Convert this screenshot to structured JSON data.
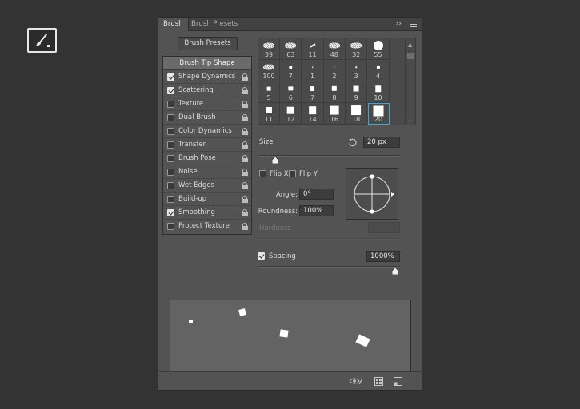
{
  "tool": {
    "icon": "brush-icon"
  },
  "tabs": [
    {
      "label": "Brush",
      "active": true
    },
    {
      "label": "Brush Presets",
      "active": false
    }
  ],
  "tab_more_glyph": "›› ",
  "brush_presets_button": "Brush Presets",
  "options_header": "Brush Tip Shape",
  "options": [
    {
      "label": "Shape Dynamics",
      "checked": true
    },
    {
      "label": "Scattering",
      "checked": true
    },
    {
      "label": "Texture",
      "checked": false
    },
    {
      "label": "Dual Brush",
      "checked": false
    },
    {
      "label": "Color Dynamics",
      "checked": false
    },
    {
      "label": "Transfer",
      "checked": false
    },
    {
      "label": "Brush Pose",
      "checked": false
    },
    {
      "label": "Noise",
      "checked": false
    },
    {
      "label": "Wet Edges",
      "checked": false
    },
    {
      "label": "Build-up",
      "checked": false
    },
    {
      "label": "Smoothing",
      "checked": true
    },
    {
      "label": "Protect Texture",
      "checked": false
    }
  ],
  "brush_tips": [
    {
      "size": "39",
      "shape": "splatter"
    },
    {
      "size": "63",
      "shape": "splatter"
    },
    {
      "size": "11",
      "shape": "stroke"
    },
    {
      "size": "48",
      "shape": "splatter"
    },
    {
      "size": "32",
      "shape": "splatter"
    },
    {
      "size": "55",
      "shape": "round"
    },
    {
      "size": "100",
      "shape": "splatter"
    },
    {
      "size": "7",
      "shape": "dot"
    },
    {
      "size": "1",
      "shape": "dot"
    },
    {
      "size": "2",
      "shape": "dot"
    },
    {
      "size": "3",
      "shape": "dot"
    },
    {
      "size": "4",
      "shape": "square"
    },
    {
      "size": "5",
      "shape": "square"
    },
    {
      "size": "6",
      "shape": "square"
    },
    {
      "size": "7",
      "shape": "square"
    },
    {
      "size": "8",
      "shape": "square"
    },
    {
      "size": "9",
      "shape": "square"
    },
    {
      "size": "10",
      "shape": "square"
    },
    {
      "size": "11",
      "shape": "square"
    },
    {
      "size": "12",
      "shape": "square"
    },
    {
      "size": "14",
      "shape": "square"
    },
    {
      "size": "16",
      "shape": "square"
    },
    {
      "size": "18",
      "shape": "square"
    },
    {
      "size": "20",
      "shape": "square",
      "selected": true
    }
  ],
  "size": {
    "label": "Size",
    "value": "20 px",
    "slider_fraction": 0.05
  },
  "flip_x": {
    "label": "Flip X",
    "checked": false
  },
  "flip_y": {
    "label": "Flip Y",
    "checked": false
  },
  "angle": {
    "label": "Angle:",
    "value": "0°"
  },
  "roundness": {
    "label": "Roundness:",
    "value": "100%"
  },
  "hardness": {
    "label": "Hardness",
    "value": ""
  },
  "spacing": {
    "label": "Spacing",
    "checked": true,
    "value": "1000%",
    "slider_fraction": 1.0
  },
  "footer_icons": [
    "visibility-toggle-icon",
    "new-preset-grid-icon",
    "create-new-brush-icon"
  ],
  "colors": {
    "accent": "#3ea6d8",
    "panel": "#535353",
    "background": "#333333"
  }
}
